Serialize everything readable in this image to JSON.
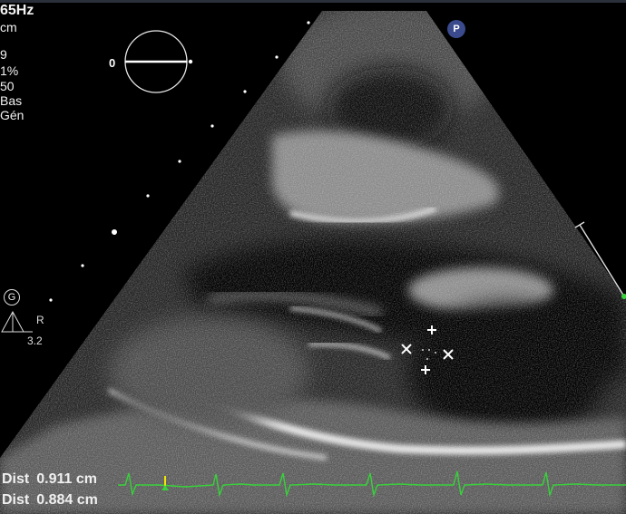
{
  "params": {
    "frequency": "65Hz",
    "depth_unit": "cm",
    "line1": "9",
    "line2": "1%",
    "line3": "50",
    "line4": "Bas",
    "line5": "Gén"
  },
  "probe_angle": "0",
  "p_badge": "P",
  "g_badge": "G",
  "r_label": "R",
  "depth_value": "3.2",
  "measurements": [
    {
      "label": "Dist",
      "value": "0.911 cm"
    },
    {
      "label": "Dist",
      "value": "0.884 cm"
    }
  ],
  "colors": {
    "ecg": "#38d23a",
    "ecg_marker": "#f2e600",
    "caliper": "#ffffff"
  }
}
